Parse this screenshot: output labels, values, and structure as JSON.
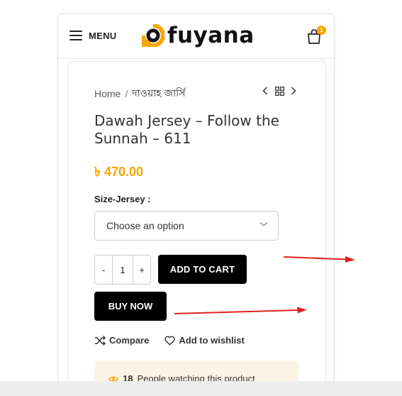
{
  "header": {
    "menu_label": "MENU",
    "logo_text": "fuyana",
    "cart_count": "1",
    "accent_color": "#f7a600"
  },
  "breadcrumb": {
    "home": "Home",
    "separator": "/",
    "current": "দাওয়াহ জার্সি"
  },
  "product": {
    "title": "Dawah Jersey – Follow the Sunnah – 611",
    "price": "৳ 470.00"
  },
  "variation": {
    "label": "Size-Jersey :",
    "selected": "Choose an option"
  },
  "quantity": {
    "minus": "-",
    "value": "1",
    "plus": "+"
  },
  "buttons": {
    "add_to_cart": "ADD TO CART",
    "buy_now": "BUY NOW"
  },
  "actions": {
    "compare": "Compare",
    "wishlist": "Add to wishlist"
  },
  "watching": {
    "count": "18",
    "text": "People watching this product"
  },
  "icons": [
    "hamburger-icon",
    "cart-icon",
    "chevron-left-icon",
    "grid-icon",
    "chevron-right-icon",
    "chevron-down-icon",
    "compare-icon",
    "heart-icon",
    "eye-icon"
  ]
}
